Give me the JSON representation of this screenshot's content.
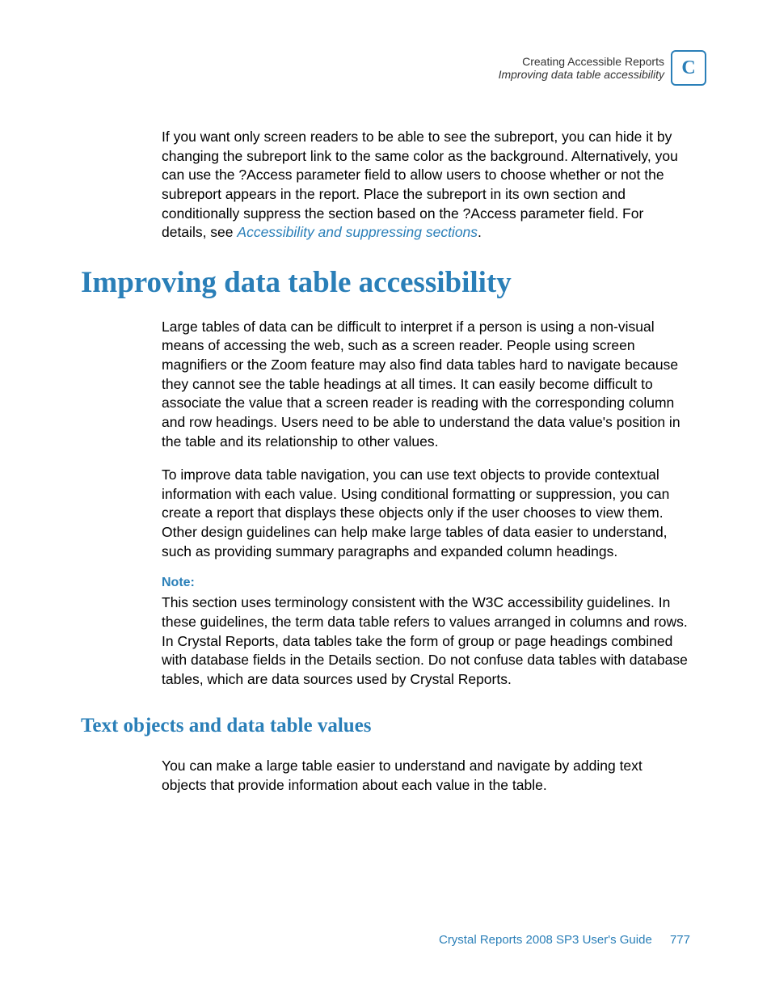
{
  "header": {
    "chapter_title": "Creating Accessible Reports",
    "section_title": "Improving data table accessibility",
    "appendix_letter": "C"
  },
  "intro_para": {
    "text_before_link": "If you want only screen readers to be able to see the subreport, you can hide it by changing the subreport link to the same color as the background. Alternatively, you can use the ?Access parameter field to allow users to choose whether or not the subreport appears in the report. Place the subreport in its own section and conditionally suppress the section based on the ?Access parameter field. For details, see ",
    "link_text": "Accessibility and suppressing sections",
    "text_after_link": "."
  },
  "heading_main": "Improving data table accessibility",
  "para1": "Large tables of data can be difficult to interpret if a person is using a non-visual means of accessing the web, such as a screen reader. People using screen magnifiers or the Zoom feature may also find data tables hard to navigate because they cannot see the table headings at all times. It can easily become difficult to associate the value that a screen reader is reading with the corresponding column and row headings. Users need to be able to understand the data value's position in the table and its relationship to other values.",
  "para2": "To improve data table navigation, you can use text objects to provide contextual information with each value. Using conditional formatting or suppression, you can create a report that displays these objects only if the user chooses to view them. Other design guidelines can help make large tables of data easier to understand, such as providing summary paragraphs and expanded column headings.",
  "note": {
    "label": "Note:",
    "text": "This section uses terminology consistent with the W3C accessibility guidelines. In these guidelines, the term data table refers to values arranged in columns and rows. In Crystal Reports, data tables take the form of group or page headings combined with database fields in the Details section. Do not confuse data tables with database tables, which are data sources used by Crystal Reports."
  },
  "heading_sub": "Text objects and data table values",
  "para3": "You can make a large table easier to understand and navigate by adding text objects that provide information about each value in the table.",
  "footer": {
    "guide_title": "Crystal Reports 2008 SP3 User's Guide",
    "page_number": "777"
  }
}
